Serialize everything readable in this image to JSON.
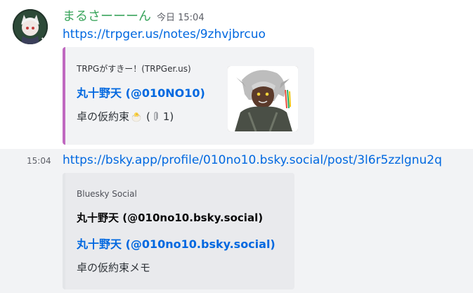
{
  "message1": {
    "username": "まるさーーーん",
    "timestamp": "今日 15:04",
    "link": "https://trpger.us/notes/9zhvjbrcuo",
    "embed": {
      "accent_color": "#c069c0",
      "provider": "TRPGがすきー！(TRPGer.us)",
      "title": "丸十野天 (@010NO10)",
      "description": "卓の仮約束",
      "reaction_open": "(",
      "reaction_icon": "paperclip-icon",
      "reaction_count": "1)"
    }
  },
  "message2": {
    "timestamp": "15:04",
    "link": "https://bsky.app/profile/010no10.bsky.social/post/3l6r5zzlgnu2q",
    "embed": {
      "accent_color": "#e3e5e8",
      "provider": "Bluesky Social",
      "author": "丸十野天 (@010no10.bsky.social)",
      "title": "丸十野天 (@010no10.bsky.social)",
      "description": "卓の仮約束メモ"
    }
  },
  "colors": {
    "username": "#3ba55d",
    "link": "#0068e0",
    "hover_bg": "#f2f3f5"
  }
}
